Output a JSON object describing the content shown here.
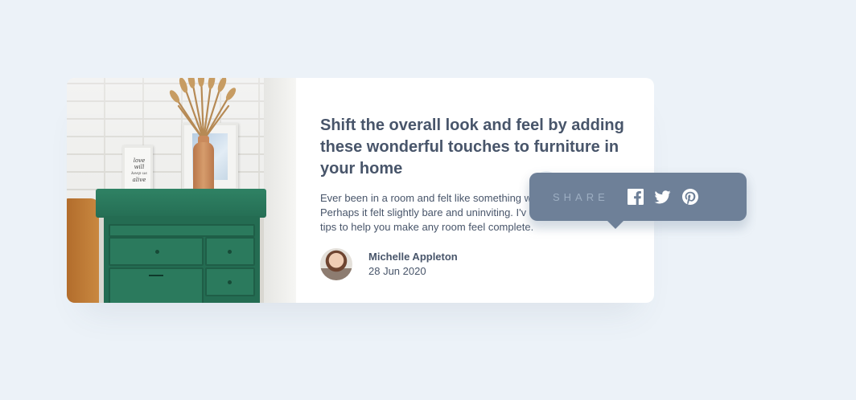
{
  "article": {
    "title": "Shift the overall look and feel by adding these wonderful touches to furniture in your home",
    "excerpt": "Ever been in a room and felt like something w Perhaps it felt slightly bare and uninviting. I'v tips to help you make any room feel complete.",
    "excerpt_lines": [
      "Ever been in a room and felt like something w",
      "Perhaps it felt slightly bare and uninviting. I'v",
      "tips to help you make any room feel complete."
    ]
  },
  "photo": {
    "frame_text": [
      "love",
      "will",
      "keep us",
      "alive"
    ]
  },
  "author": {
    "name": "Michelle Appleton",
    "date": "28 Jun 2020"
  },
  "share_popover": {
    "label": "SHARE",
    "icons": [
      "facebook-icon",
      "twitter-icon",
      "pinterest-icon"
    ]
  },
  "colors": {
    "background": "#ECF2F8",
    "text_dark": "#48556A",
    "popover": "#6E8098",
    "popover_label": "#9DAEC2",
    "dresser_green": "#2B7A5D"
  }
}
